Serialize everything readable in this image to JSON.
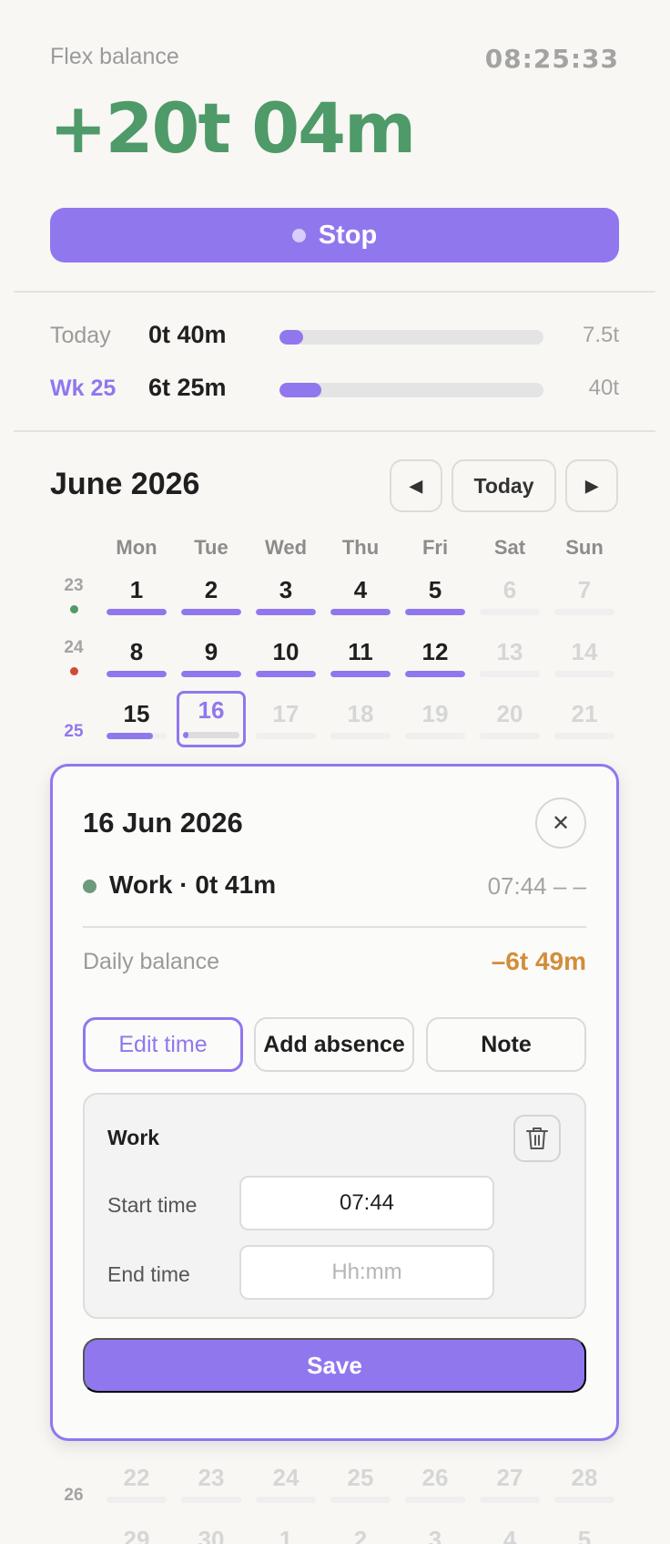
{
  "header": {
    "label": "Flex balance",
    "clock": "08:25:33",
    "balance": "+20t 04m"
  },
  "stop_button": {
    "label": "Stop"
  },
  "progress": {
    "today": {
      "label": "Today",
      "value": "0t 40m",
      "max": "7.5t",
      "fraction": 0.089
    },
    "week": {
      "label": "Wk 25",
      "value": "6t 25m",
      "max": "40t",
      "fraction": 0.16
    }
  },
  "calendar": {
    "title": "June 2026",
    "nav": {
      "prev": "◀",
      "today": "Today",
      "next": "▶"
    },
    "weekdays": [
      "Mon",
      "Tue",
      "Wed",
      "Thu",
      "Fri",
      "Sat",
      "Sun"
    ],
    "weeks": [
      {
        "num": "23",
        "dot": "#4e9a68",
        "current": false,
        "days": [
          {
            "n": "1",
            "kind": "work",
            "fill": 1
          },
          {
            "n": "2",
            "kind": "work",
            "fill": 1
          },
          {
            "n": "3",
            "kind": "work",
            "fill": 1
          },
          {
            "n": "4",
            "kind": "work",
            "fill": 1
          },
          {
            "n": "5",
            "kind": "work",
            "fill": 1
          },
          {
            "n": "6",
            "kind": "weekend",
            "fill": 0
          },
          {
            "n": "7",
            "kind": "weekend",
            "fill": 0
          }
        ]
      },
      {
        "num": "24",
        "dot": "#d14a35",
        "current": false,
        "days": [
          {
            "n": "8",
            "kind": "work",
            "fill": 1
          },
          {
            "n": "9",
            "kind": "work",
            "fill": 1
          },
          {
            "n": "10",
            "kind": "work",
            "fill": 1
          },
          {
            "n": "11",
            "kind": "work",
            "fill": 1
          },
          {
            "n": "12",
            "kind": "work",
            "fill": 1
          },
          {
            "n": "13",
            "kind": "weekend",
            "fill": 0
          },
          {
            "n": "14",
            "kind": "weekend",
            "fill": 0
          }
        ]
      },
      {
        "num": "25",
        "dot": "",
        "current": true,
        "days": [
          {
            "n": "15",
            "kind": "work",
            "fill": 0.77
          },
          {
            "n": "16",
            "kind": "selected",
            "fill": 0.09
          },
          {
            "n": "17",
            "kind": "future",
            "fill": 0
          },
          {
            "n": "18",
            "kind": "future",
            "fill": 0
          },
          {
            "n": "19",
            "kind": "future",
            "fill": 0
          },
          {
            "n": "20",
            "kind": "future",
            "fill": 0
          },
          {
            "n": "21",
            "kind": "future",
            "fill": 0
          }
        ]
      },
      {
        "num": "26",
        "dot": "",
        "current": false,
        "days": [
          {
            "n": "22",
            "kind": "future",
            "fill": 0
          },
          {
            "n": "23",
            "kind": "future",
            "fill": 0
          },
          {
            "n": "24",
            "kind": "future",
            "fill": 0
          },
          {
            "n": "25",
            "kind": "future",
            "fill": 0
          },
          {
            "n": "26",
            "kind": "future",
            "fill": 0
          },
          {
            "n": "27",
            "kind": "future",
            "fill": 0
          },
          {
            "n": "28",
            "kind": "future",
            "fill": 0
          }
        ]
      },
      {
        "num": "",
        "dot": "",
        "current": false,
        "days": [
          {
            "n": "29",
            "kind": "future",
            "fill": 0
          },
          {
            "n": "30",
            "kind": "future",
            "fill": 0
          },
          {
            "n": "1",
            "kind": "future",
            "fill": 0
          },
          {
            "n": "2",
            "kind": "future",
            "fill": 0
          },
          {
            "n": "3",
            "kind": "future",
            "fill": 0
          },
          {
            "n": "4",
            "kind": "future",
            "fill": 0
          },
          {
            "n": "5",
            "kind": "future",
            "fill": 0
          }
        ]
      }
    ]
  },
  "popup": {
    "date": "16 Jun 2026",
    "close": "✕",
    "entry": {
      "label": "Work · 0t 41m",
      "range": "07:44 – –"
    },
    "daily_balance": {
      "label": "Daily balance",
      "value": "–6t 49m"
    },
    "actions": {
      "edit": "Edit time",
      "absence": "Add absence",
      "note": "Note"
    },
    "editor": {
      "title": "Work",
      "start_label": "Start time",
      "start_value": "07:44",
      "end_label": "End time",
      "end_placeholder": "Hh:mm"
    },
    "save": "Save"
  }
}
